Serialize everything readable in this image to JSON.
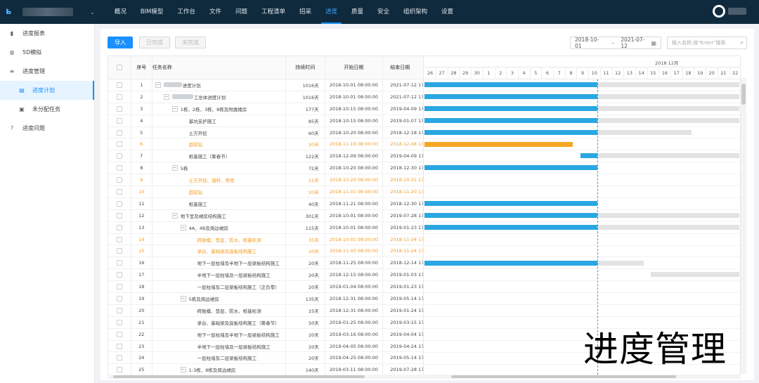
{
  "nav": {
    "items": [
      "概况",
      "BIM模型",
      "工作台",
      "文件",
      "问题",
      "工程清单",
      "招采",
      "进度",
      "质量",
      "安全",
      "组织架构",
      "设置"
    ],
    "active_index": 7
  },
  "sidebar": {
    "items": [
      {
        "label": "进度报表",
        "icon": "chart-icon"
      },
      {
        "label": "5D模拟",
        "icon": "globe-icon"
      },
      {
        "label": "进度管理",
        "icon": "list-icon"
      },
      {
        "label": "进度计划",
        "icon": "table-icon",
        "sub": true,
        "active": true
      },
      {
        "label": "未分配任务",
        "icon": "task-icon",
        "sub": true
      },
      {
        "label": "进度问题",
        "icon": "question-icon"
      }
    ]
  },
  "toolbar": {
    "import_label": "导入",
    "done_label": "已完成",
    "undone_label": "未完成",
    "date_start": "2018-10-01",
    "date_sep": "~",
    "date_end": "2021-07-12",
    "search_placeholder": "输入名称,按\"Enter\"搜索"
  },
  "grid": {
    "headers": {
      "index": "序号",
      "name": "任务名称",
      "duration": "持续时间",
      "start": "开始日期",
      "end": "结束日期"
    },
    "rows": [
      {
        "idx": "1",
        "name": "进度计划",
        "dur": "1016天",
        "start": "2018-10-01 08:00:00",
        "end": "2021-07-12 17",
        "level": 0,
        "toggle": "-",
        "orange": false
      },
      {
        "idx": "2",
        "name": "工总体进度计划",
        "dur": "1016天",
        "start": "2018-10-01 08:00:00",
        "end": "2021-07-12 17",
        "level": 1,
        "toggle": "-",
        "orange": false
      },
      {
        "idx": "3",
        "name": "1栋、2栋、3栋、8栋及附属楼房",
        "dur": "177天",
        "start": "2018-10-15 08:00:00",
        "end": "2019-04-09 17",
        "level": 2,
        "toggle": "-",
        "orange": false
      },
      {
        "idx": "4",
        "name": "基坑支护施工",
        "dur": "85天",
        "start": "2018-10-15 08:00:00",
        "end": "2019-01-07 17",
        "level": 3,
        "toggle": "",
        "orange": false
      },
      {
        "idx": "5",
        "name": "土方开挖",
        "dur": "60天",
        "start": "2018-10-20 08:00:00",
        "end": "2018-12-18 17",
        "level": 3,
        "toggle": "",
        "orange": false
      },
      {
        "idx": "6",
        "name": "超前钻",
        "dur": "20天",
        "start": "2018-11-19 08:00:00",
        "end": "2018-12-08 17",
        "level": 3,
        "toggle": "",
        "orange": true
      },
      {
        "idx": "7",
        "name": "桩基施工（筹春节）",
        "dur": "122天",
        "start": "2018-12-09 08:00:00",
        "end": "2019-04-09 17",
        "level": 3,
        "toggle": "",
        "orange": false
      },
      {
        "idx": "8",
        "name": "5栋",
        "dur": "72天",
        "start": "2018-10-20 08:00:00",
        "end": "2018-12-30 17",
        "level": 2,
        "toggle": "-",
        "orange": false
      },
      {
        "idx": "9",
        "name": "土方开挖、锚杆、喷浆",
        "dur": "12天",
        "start": "2018-10-20 08:00:00",
        "end": "2018-10-31 17",
        "level": 3,
        "toggle": "",
        "orange": true
      },
      {
        "idx": "10",
        "name": "超前钻",
        "dur": "20天",
        "start": "2018-11-01 08:00:00",
        "end": "2018-11-20 17",
        "level": 3,
        "toggle": "",
        "orange": true
      },
      {
        "idx": "11",
        "name": "桩基施工",
        "dur": "40天",
        "start": "2018-11-21 08:00:00",
        "end": "2018-12-30 17",
        "level": 3,
        "toggle": "",
        "orange": false
      },
      {
        "idx": "12",
        "name": "地下室及裙房结构施工",
        "dur": "301天",
        "start": "2018-10-01 08:00:00",
        "end": "2019-07-28 17",
        "level": 2,
        "toggle": "-",
        "orange": false
      },
      {
        "idx": "13",
        "name": "4A、4B及周边裙房",
        "dur": "115天",
        "start": "2018-10-01 08:00:00",
        "end": "2019-01-23 17",
        "level": 3,
        "toggle": "-",
        "orange": false
      },
      {
        "idx": "14",
        "name": "砖胎模、垫层、防水、桩基检测",
        "dur": "35天",
        "start": "2018-10-01 08:00:00",
        "end": "2018-11-04 17",
        "level": 4,
        "toggle": "",
        "orange": true
      },
      {
        "idx": "15",
        "name": "承台、基础梁及底板结构施工",
        "dur": "20天",
        "start": "2018-11-05 08:00:00",
        "end": "2018-11-24 17",
        "level": 4,
        "toggle": "",
        "orange": true
      },
      {
        "idx": "16",
        "name": "地下一层柱墙及半地下一层梁板结构施工",
        "dur": "20天",
        "start": "2018-11-25 08:00:00",
        "end": "2018-12-14 17",
        "level": 4,
        "toggle": "",
        "orange": false
      },
      {
        "idx": "17",
        "name": "半地下一层柱墙及一层梁板结构施工",
        "dur": "20天",
        "start": "2018-12-15 08:00:00",
        "end": "2019-01-03 17",
        "level": 4,
        "toggle": "",
        "orange": false
      },
      {
        "idx": "18",
        "name": "一层柱墙及二层梁板结构施工（正负零）",
        "dur": "20天",
        "start": "2019-01-04 08:00:00",
        "end": "2019-01-23 17",
        "level": 4,
        "toggle": "",
        "orange": false
      },
      {
        "idx": "19",
        "name": "5栋及周边裙房",
        "dur": "135天",
        "start": "2018-12-31 08:00:00",
        "end": "2019-05-14 17",
        "level": 3,
        "toggle": "-",
        "orange": false
      },
      {
        "idx": "20",
        "name": "砖胎模、垫层、防水、桩基检测",
        "dur": "25天",
        "start": "2018-12-31 08:00:00",
        "end": "2019-01-24 17",
        "level": 4,
        "toggle": "",
        "orange": false
      },
      {
        "idx": "21",
        "name": "承台、基础梁及底板结构施工（筹春节）",
        "dur": "50天",
        "start": "2019-01-25 08:00:00",
        "end": "2019-03-15 17",
        "level": 4,
        "toggle": "",
        "orange": false
      },
      {
        "idx": "22",
        "name": "地下一层柱墙及半地下一层梁板结构施工",
        "dur": "20天",
        "start": "2019-03-16 08:00:00",
        "end": "2019-04-04 17",
        "level": 4,
        "toggle": "",
        "orange": false
      },
      {
        "idx": "23",
        "name": "半地下一层柱墙及一层梁板结构施工",
        "dur": "20天",
        "start": "2019-04-05 08:00:00",
        "end": "2019-04-24 17",
        "level": 4,
        "toggle": "",
        "orange": false
      },
      {
        "idx": "24",
        "name": "一层柱墙及二层梁板结构施工",
        "dur": "20天",
        "start": "2019-04-25 08:00:00",
        "end": "2019-05-14 17",
        "level": 4,
        "toggle": "",
        "orange": false
      },
      {
        "idx": "25",
        "name": "1-3栋、8栋及周边裙房",
        "dur": "140天",
        "start": "2019-03-11 08:00:00",
        "end": "2019-07-28 17",
        "level": 3,
        "toggle": "-",
        "orange": false
      }
    ]
  },
  "gantt": {
    "month_label": "2018 12月",
    "days": [
      "26",
      "27",
      "28",
      "29",
      "30",
      "1",
      "2",
      "3",
      "4",
      "5",
      "6",
      "7",
      "8",
      "9",
      "10",
      "11",
      "12",
      "13",
      "14",
      "15",
      "16",
      "17",
      "18",
      "19",
      "20",
      "21",
      "22"
    ],
    "bars": [
      [
        {
          "type": "done",
          "s": 0,
          "e": 246
        },
        {
          "type": "rest",
          "s": 246,
          "e": 448
        }
      ],
      [
        {
          "type": "done",
          "s": 0,
          "e": 246
        },
        {
          "type": "rest",
          "s": 246,
          "e": 448
        }
      ],
      [
        {
          "type": "done",
          "s": 0,
          "e": 246
        },
        {
          "type": "rest",
          "s": 246,
          "e": 448
        }
      ],
      [
        {
          "type": "done",
          "s": 0,
          "e": 246
        },
        {
          "type": "rest",
          "s": 246,
          "e": 448
        }
      ],
      [
        {
          "type": "done",
          "s": 0,
          "e": 246
        },
        {
          "type": "rest",
          "s": 246,
          "e": 380
        }
      ],
      [
        {
          "type": "late",
          "s": 0,
          "e": 211
        }
      ],
      [
        {
          "type": "done",
          "s": 222,
          "e": 246
        },
        {
          "type": "rest",
          "s": 246,
          "e": 448
        }
      ],
      [
        {
          "type": "done",
          "s": 0,
          "e": 246
        }
      ],
      [],
      [],
      [
        {
          "type": "done",
          "s": 0,
          "e": 246
        }
      ],
      [
        {
          "type": "done",
          "s": 0,
          "e": 246
        },
        {
          "type": "rest",
          "s": 246,
          "e": 448
        }
      ],
      [
        {
          "type": "done",
          "s": 0,
          "e": 246
        },
        {
          "type": "rest",
          "s": 246,
          "e": 448
        }
      ],
      [],
      [],
      [
        {
          "type": "done",
          "s": 0,
          "e": 246
        },
        {
          "type": "rest",
          "s": 246,
          "e": 312
        }
      ],
      [
        {
          "type": "rest",
          "s": 322,
          "e": 448
        }
      ],
      [],
      [],
      [],
      [],
      [],
      [],
      [],
      []
    ]
  },
  "overlay_text": "进度管理"
}
